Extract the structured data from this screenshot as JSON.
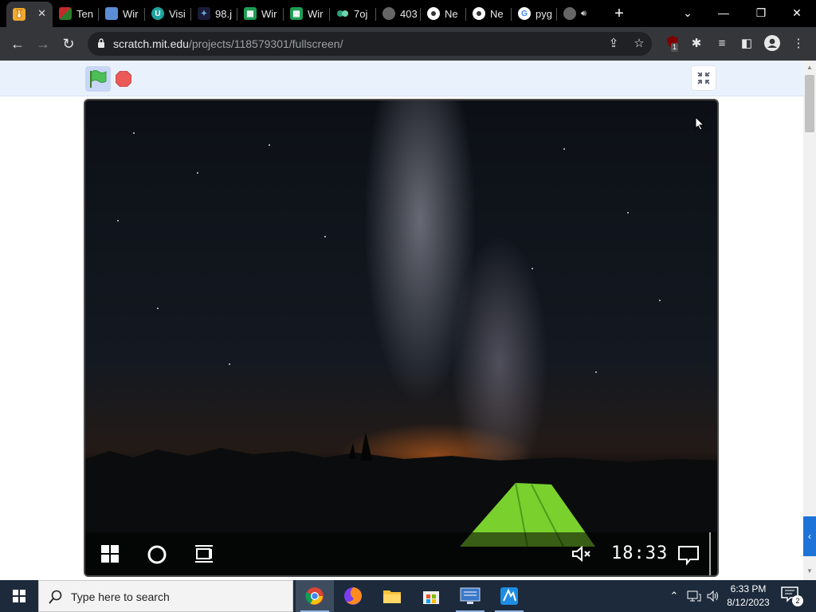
{
  "browser": {
    "tabs": [
      {
        "label": "",
        "favicon": "scratch-cat-icon",
        "active": true,
        "close_label": "✕"
      },
      {
        "label": "Ten",
        "favicon": "ten-icon"
      },
      {
        "label": "Wir",
        "favicon": "wir-icon"
      },
      {
        "label": "Visi",
        "favicon": "u-icon"
      },
      {
        "label": "98.j",
        "favicon": "bird-icon"
      },
      {
        "label": "Wir",
        "favicon": "sheet-icon"
      },
      {
        "label": "Wir",
        "favicon": "sheet-icon"
      },
      {
        "label": "7oj",
        "favicon": "dots-icon"
      },
      {
        "label": "403",
        "favicon": "globe-icon"
      },
      {
        "label": "Ne",
        "favicon": "chrome-dark-icon"
      },
      {
        "label": "Ne",
        "favicon": "chrome-dark-icon"
      },
      {
        "label": "pyg",
        "favicon": "google-icon"
      },
      {
        "label": "",
        "favicon": "globe-audio-icon"
      }
    ],
    "new_tab_label": "+",
    "url_host": "scratch.mit.edu",
    "url_path": "/projects/118579301/fullscreen/",
    "extension_badge": "1"
  },
  "inner_clock": "18:33",
  "taskbar": {
    "search_placeholder": "Type here to search",
    "time": "6:33 PM",
    "date": "8/12/2023",
    "notification_count": "2"
  },
  "colors": {
    "tab_bar": "#000000",
    "toolbar": "#35363a",
    "scratch_controls": "#e9f1fc",
    "taskbar": "#1c2a3b",
    "side_tab": "#1e73d8"
  }
}
